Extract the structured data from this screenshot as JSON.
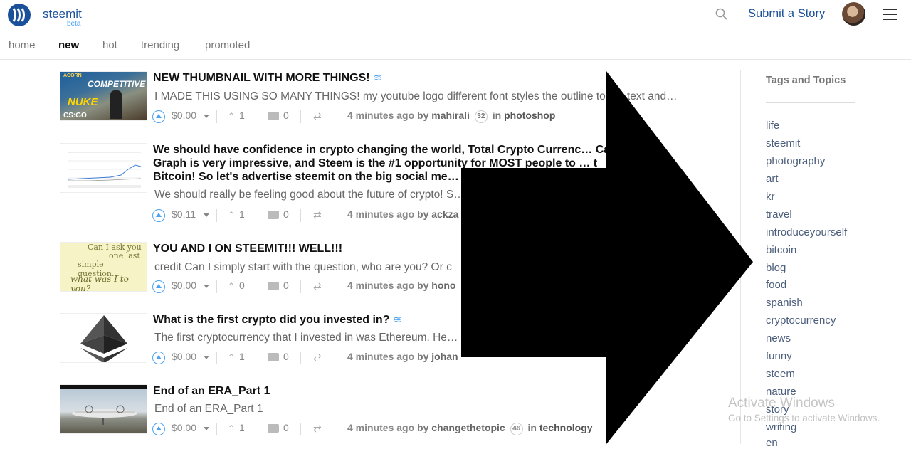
{
  "header": {
    "brand": "steemit",
    "brand_sub": "beta",
    "submit_label": "Submit a Story",
    "icons": [
      "steemit-logo-icon",
      "search-icon",
      "avatar",
      "hamburger-menu-icon"
    ]
  },
  "nav": {
    "items": [
      {
        "label": "home",
        "active": false
      },
      {
        "label": "new",
        "active": true
      },
      {
        "label": "hot",
        "active": false
      },
      {
        "label": "trending",
        "active": false
      },
      {
        "label": "promoted",
        "active": false
      }
    ]
  },
  "posts": [
    {
      "title": "NEW THUMBNAIL WITH MORE THINGS!",
      "body": "I MADE THIS USING SO MANY THINGS! my youtube logo different font styles the outline to the text and…",
      "payout": "$0.00",
      "votes": "1",
      "comments": "0",
      "time": "4 minutes ago",
      "by": "by",
      "author": "mahirali",
      "rep": "32",
      "in": "in",
      "category": "photoshop",
      "thumb_text": [
        "ACORN",
        "COMPETITIVE",
        "NUKE",
        "CS:GO"
      ]
    },
    {
      "title_lines": [
        "We should have confidence in crypto changing the world, Total Crypto Currenc… Cap",
        "Graph is very impressive, and Steem is the #1 opportunity for MOST people to … t",
        "Bitcoin! So let's advertise steemit on the big social me…"
      ],
      "body": "We should really be feeling good about the future of crypto! S… f…",
      "payout": "$0.11",
      "votes": "1",
      "comments": "0",
      "time": "4 minutes ago",
      "by": "by",
      "author": "ackza"
    },
    {
      "title": "YOU AND I ON STEEMIT!!! WELL!!!",
      "body": "credit Can I simply start with the question, who are you? Or c",
      "payout": "$0.00",
      "votes": "0",
      "comments": "0",
      "time": "4 minutes ago",
      "by": "by",
      "author": "hono",
      "thumb_text": [
        "Can I ask you",
        "one last",
        "simple question…",
        "what was I to you?"
      ]
    },
    {
      "title": "What is the first crypto did you invested in?",
      "body": "The first cryptocurrency that I invested in was Ethereum. He… o…",
      "payout": "$0.00",
      "votes": "1",
      "comments": "0",
      "time": "4 minutes ago",
      "by": "by",
      "author": "johan"
    },
    {
      "title": "End of an ERA_Part 1",
      "body": "End of an ERA_Part 1",
      "payout": "$0.00",
      "votes": "1",
      "comments": "0",
      "time": "4 minutes ago",
      "by": "by",
      "author": "changethetopic",
      "rep": "46",
      "in": "in",
      "category": "technology"
    }
  ],
  "sidebar": {
    "title": "Tags and Topics",
    "tags": [
      "life",
      "steemit",
      "photography",
      "art",
      "kr",
      "travel",
      "introduceyourself",
      "bitcoin",
      "blog",
      "food",
      "spanish",
      "cryptocurrency",
      "news",
      "funny",
      "steem",
      "nature",
      "story",
      "writing",
      "en"
    ]
  },
  "watermark": {
    "line1": "Activate Windows",
    "line2": "Go to Settings to activate Windows."
  },
  "colors": {
    "brand": "#1a5099",
    "accent": "#4ba2f2",
    "overlay_arrow": "#000000"
  }
}
